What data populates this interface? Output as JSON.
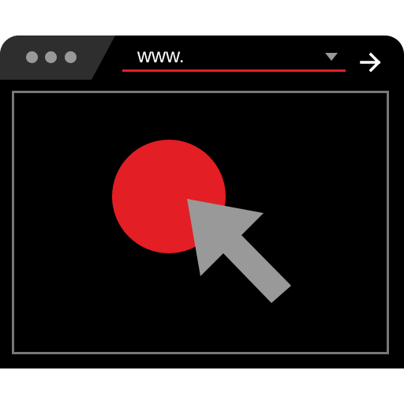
{
  "browser": {
    "address_bar": {
      "value": "www."
    }
  },
  "colors": {
    "frame": "#000000",
    "accent": "#e31e24",
    "dots": "#999999",
    "content_border": "#777777",
    "cursor": "#999999",
    "text": "#ffffff"
  },
  "icons": {
    "window_controls": [
      "dot",
      "dot",
      "dot"
    ],
    "dropdown": "caret-down-icon",
    "go": "arrow-right-icon",
    "cursor": "mouse-pointer-icon",
    "record": "record-circle"
  }
}
